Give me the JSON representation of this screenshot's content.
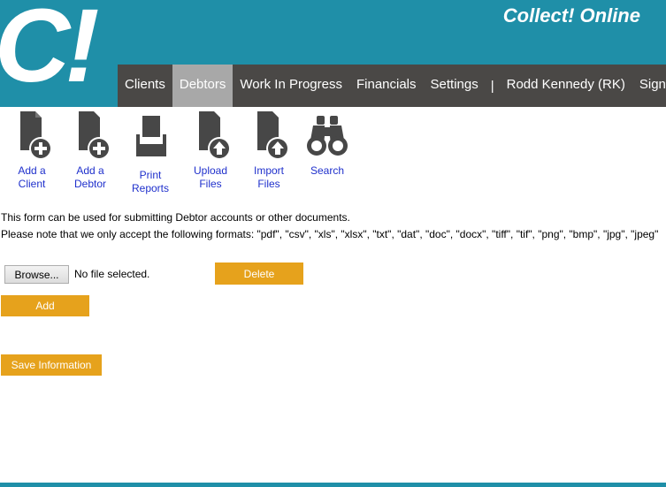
{
  "header": {
    "logo_text": "C!",
    "app_title": "Collect! Online",
    "bg_color": "#1f8fa8"
  },
  "nav": {
    "items": [
      {
        "label": "Clients"
      },
      {
        "label": "Debtors",
        "active": true
      },
      {
        "label": "Work In Progress"
      },
      {
        "label": "Financials"
      },
      {
        "label": "Settings"
      },
      {
        "label": "Rodd Kennedy (RK)"
      },
      {
        "label": "Sign Out"
      }
    ],
    "separator": "|",
    "active_color": "#a8a8a8",
    "bg_color": "#4a4846"
  },
  "toolbar": {
    "add_client": {
      "label": "Add a\nClient",
      "icon": "document-plus-icon"
    },
    "add_debtor": {
      "label": "Add a\nDebtor",
      "icon": "document-plus-icon"
    },
    "print_reports": {
      "label": "Print\nReports",
      "icon": "printer-icon"
    },
    "upload_files": {
      "label": "Upload\nFiles",
      "icon": "document-upload-icon"
    },
    "import_files": {
      "label": "Import\nFiles",
      "icon": "document-upload-icon"
    },
    "search": {
      "label": "Search",
      "icon": "binoculars-icon"
    },
    "link_color": "#1f30cc"
  },
  "form": {
    "note_line_1": "This form can be used for submitting Debtor accounts or other documents.",
    "note_line_2": "Please note that we only accept the following formats: \"pdf\", \"csv\", \"xls\", \"xlsx\", \"txt\", \"dat\", \"doc\", \"docx\", \"tiff\", \"tif\", \"png\", \"bmp\", \"jpg\", \"jpeg\"",
    "browse_label": "Browse...",
    "file_status": "No file selected.",
    "delete_label": "Delete",
    "add_label": "Add",
    "save_label": "Save Information",
    "button_color": "#e6a21c"
  }
}
